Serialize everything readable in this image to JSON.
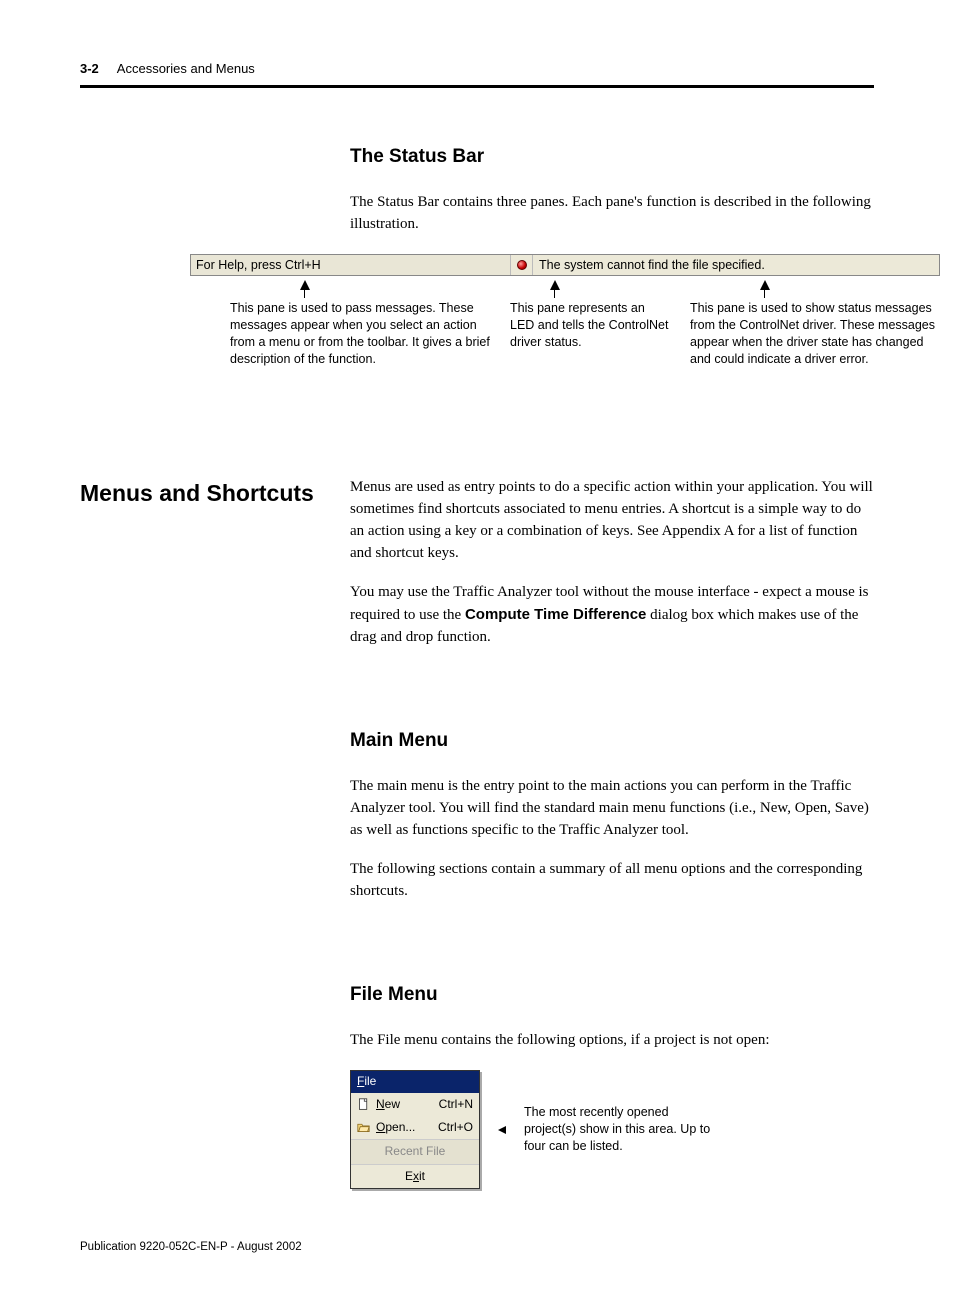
{
  "header": {
    "page_num": "3-2",
    "chapter": "Accessories and Menus"
  },
  "status_bar_section": {
    "title": "The Status Bar",
    "intro": "The Status Bar contains three panes. Each pane's function is described in the following illustration.",
    "pane1_text": "For Help, press Ctrl+H",
    "pane3_text": "The system cannot find the file specified.",
    "ann1": "This pane is used to pass messages. These messages appear when you select an action from a menu or from the toolbar. It gives a brief description of the function.",
    "ann2": "This pane represents an LED and tells the ControlNet driver status.",
    "ann3": "This pane is used to show status messages from the ControlNet driver. These messages appear when the driver state has changed and could indicate a driver error."
  },
  "menus_section": {
    "title": "Menus and Shortcuts",
    "p1": "Menus are used as entry points to do a specific action within your application. You will sometimes find shortcuts associated to menu entries. A shortcut is a simple way to do an action using a key or a combination of keys. See Appendix A for a list of function and shortcut keys.",
    "p2a": "You may use the Traffic Analyzer tool without the mouse interface - expect a mouse is required to use the ",
    "p2_bold": "Compute Time Difference",
    "p2b": " dialog box which makes use of the drag and drop function."
  },
  "main_menu_section": {
    "title": "Main Menu",
    "p1": "The main menu is the entry point to the main actions you can perform in the Traffic Analyzer tool. You will find the standard main menu functions (i.e., New, Open, Save) as well as functions specific to the Traffic Analyzer tool.",
    "p2": "The following sections contain a summary of all menu options and the corresponding shortcuts."
  },
  "file_menu_section": {
    "title": "File Menu",
    "intro": "The File menu contains the following options, if a project is not open:",
    "menu_title": "File",
    "items": {
      "new_label": "New",
      "new_short": "Ctrl+N",
      "open_label": "Open...",
      "open_short": "Ctrl+O",
      "recent_label": "Recent File",
      "exit_label": "Exit"
    },
    "callout": "The most recently opened project(s) show in this area. Up to four can be listed."
  },
  "footer": "Publication 9220-052C-EN-P - August 2002"
}
